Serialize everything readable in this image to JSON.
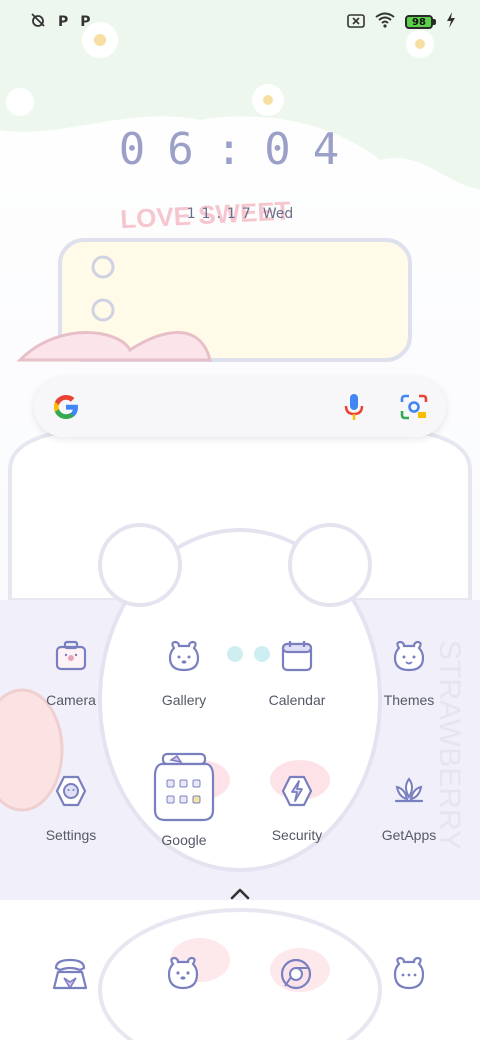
{
  "status_bar": {
    "left_icons": [
      "alarm-off-icon",
      "p-icon",
      "p-icon"
    ],
    "p1": "P",
    "p2": "P",
    "battery_level": "98",
    "right_icons": [
      "no-sim-icon",
      "wifi-icon",
      "battery-icon",
      "charging-icon"
    ]
  },
  "clock": {
    "time": "06:04",
    "date": "11.17",
    "weekday": "Wed"
  },
  "search": {
    "icons": [
      "google-logo-icon",
      "mic-icon",
      "lens-icon"
    ]
  },
  "apps": [
    {
      "label": "Camera"
    },
    {
      "label": "Gallery"
    },
    {
      "label": "Calendar"
    },
    {
      "label": "Themes"
    },
    {
      "label": "Settings"
    },
    {
      "label": "Google"
    },
    {
      "label": "Security"
    },
    {
      "label": "GetApps"
    }
  ],
  "dock": {
    "icons": [
      "phone-icon",
      "messages-icon",
      "chrome-icon",
      "contacts-icon"
    ]
  },
  "colors": {
    "icon_stroke": "#7a7fc0",
    "label": "#555866",
    "clock": "#9aa0c8"
  }
}
